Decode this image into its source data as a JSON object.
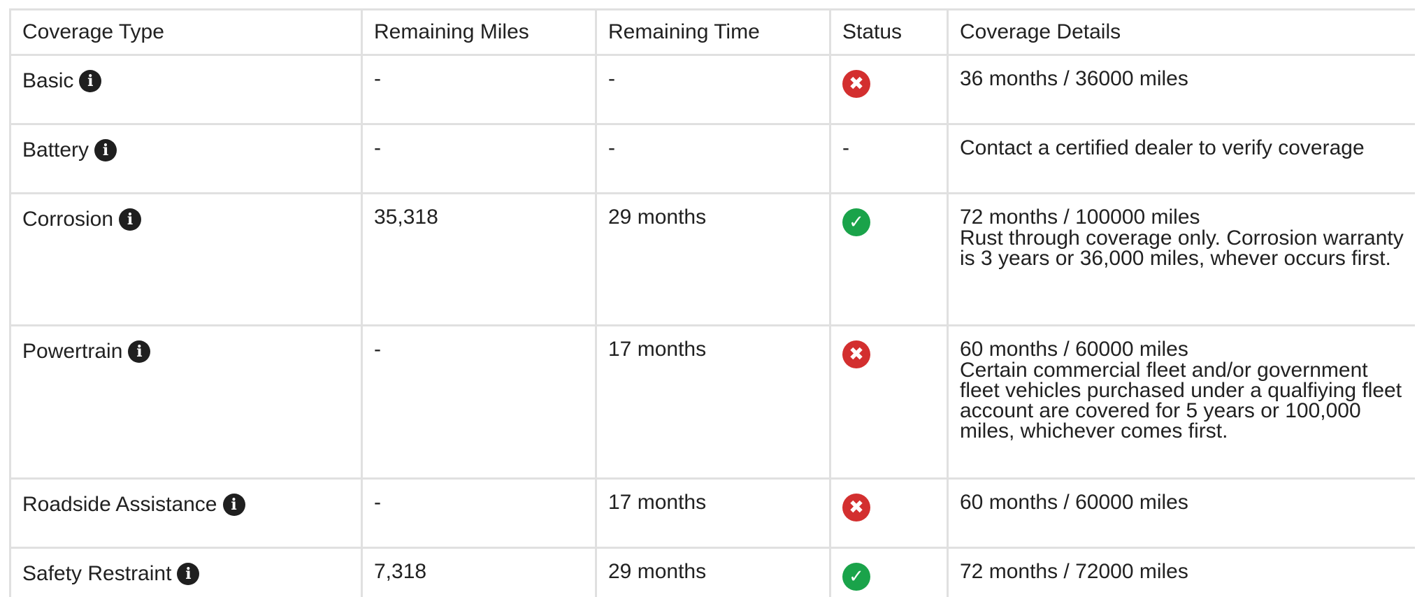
{
  "table": {
    "headers": {
      "type": "Coverage Type",
      "miles": "Remaining Miles",
      "time": "Remaining Time",
      "status": "Status",
      "details": "Coverage Details"
    },
    "rows": [
      {
        "type": "Basic",
        "miles": "-",
        "time": "-",
        "status": "inactive",
        "status_glyph": "✖",
        "details": "36 months / 36000 miles",
        "note": ""
      },
      {
        "type": "Battery",
        "miles": "-",
        "time": "-",
        "status": "none",
        "status_text": "-",
        "details": "Contact a certified dealer to verify coverage",
        "note": ""
      },
      {
        "type": "Corrosion",
        "miles": "35,318",
        "time": "29 months",
        "status": "active",
        "status_glyph": "✓",
        "details": "72 months / 100000 miles",
        "note": "Rust through coverage only. Corrosion warranty is 3 years or 36,000 miles, whever occurs first."
      },
      {
        "type": "Powertrain",
        "miles": "-",
        "time": "17 months",
        "status": "inactive",
        "status_glyph": "✖",
        "details": "60 months / 60000 miles",
        "note": "Certain commercial fleet and/or government fleet vehicles purchased under a qualfiying fleet account are covered for 5 years or 100,000 miles, whichever comes first."
      },
      {
        "type": "Roadside Assistance",
        "miles": "-",
        "time": "17 months",
        "status": "inactive",
        "status_glyph": "✖",
        "details": "60 months / 60000 miles",
        "note": ""
      },
      {
        "type": "Safety Restraint",
        "miles": "7,318",
        "time": "29 months",
        "status": "active",
        "status_glyph": "✓",
        "details": "72 months / 72000 miles",
        "note": ""
      }
    ]
  },
  "icons": {
    "info": "info-icon",
    "active": "check-circle-icon",
    "inactive": "x-circle-icon"
  },
  "colors": {
    "active": "#1aa34a",
    "inactive": "#d32f2f",
    "info": "#1f1f1f",
    "border": "#e0e0e0"
  }
}
